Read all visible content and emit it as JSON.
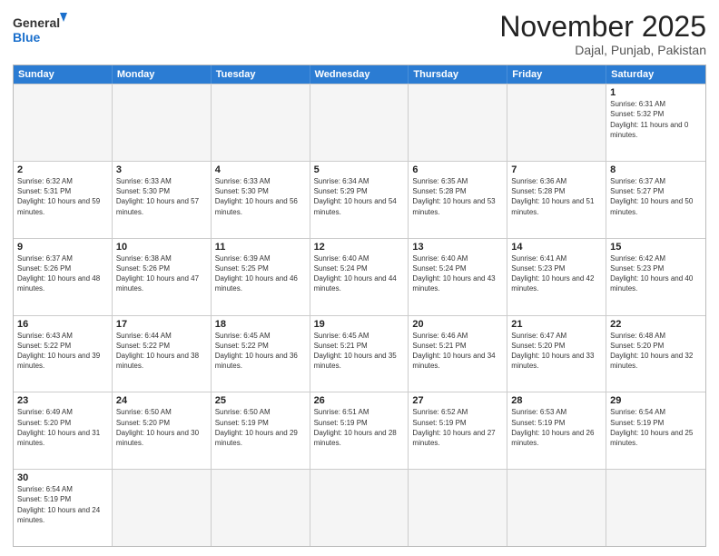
{
  "logo": {
    "text_general": "General",
    "text_blue": "Blue"
  },
  "title": "November 2025",
  "location": "Dajal, Punjab, Pakistan",
  "header_days": [
    "Sunday",
    "Monday",
    "Tuesday",
    "Wednesday",
    "Thursday",
    "Friday",
    "Saturday"
  ],
  "rows": [
    [
      {
        "day": "",
        "info": ""
      },
      {
        "day": "",
        "info": ""
      },
      {
        "day": "",
        "info": ""
      },
      {
        "day": "",
        "info": ""
      },
      {
        "day": "",
        "info": ""
      },
      {
        "day": "",
        "info": ""
      },
      {
        "day": "1",
        "info": "Sunrise: 6:31 AM\nSunset: 5:32 PM\nDaylight: 11 hours and 0 minutes."
      }
    ],
    [
      {
        "day": "2",
        "info": "Sunrise: 6:32 AM\nSunset: 5:31 PM\nDaylight: 10 hours and 59 minutes."
      },
      {
        "day": "3",
        "info": "Sunrise: 6:33 AM\nSunset: 5:30 PM\nDaylight: 10 hours and 57 minutes."
      },
      {
        "day": "4",
        "info": "Sunrise: 6:33 AM\nSunset: 5:30 PM\nDaylight: 10 hours and 56 minutes."
      },
      {
        "day": "5",
        "info": "Sunrise: 6:34 AM\nSunset: 5:29 PM\nDaylight: 10 hours and 54 minutes."
      },
      {
        "day": "6",
        "info": "Sunrise: 6:35 AM\nSunset: 5:28 PM\nDaylight: 10 hours and 53 minutes."
      },
      {
        "day": "7",
        "info": "Sunrise: 6:36 AM\nSunset: 5:28 PM\nDaylight: 10 hours and 51 minutes."
      },
      {
        "day": "8",
        "info": "Sunrise: 6:37 AM\nSunset: 5:27 PM\nDaylight: 10 hours and 50 minutes."
      }
    ],
    [
      {
        "day": "9",
        "info": "Sunrise: 6:37 AM\nSunset: 5:26 PM\nDaylight: 10 hours and 48 minutes."
      },
      {
        "day": "10",
        "info": "Sunrise: 6:38 AM\nSunset: 5:26 PM\nDaylight: 10 hours and 47 minutes."
      },
      {
        "day": "11",
        "info": "Sunrise: 6:39 AM\nSunset: 5:25 PM\nDaylight: 10 hours and 46 minutes."
      },
      {
        "day": "12",
        "info": "Sunrise: 6:40 AM\nSunset: 5:24 PM\nDaylight: 10 hours and 44 minutes."
      },
      {
        "day": "13",
        "info": "Sunrise: 6:40 AM\nSunset: 5:24 PM\nDaylight: 10 hours and 43 minutes."
      },
      {
        "day": "14",
        "info": "Sunrise: 6:41 AM\nSunset: 5:23 PM\nDaylight: 10 hours and 42 minutes."
      },
      {
        "day": "15",
        "info": "Sunrise: 6:42 AM\nSunset: 5:23 PM\nDaylight: 10 hours and 40 minutes."
      }
    ],
    [
      {
        "day": "16",
        "info": "Sunrise: 6:43 AM\nSunset: 5:22 PM\nDaylight: 10 hours and 39 minutes."
      },
      {
        "day": "17",
        "info": "Sunrise: 6:44 AM\nSunset: 5:22 PM\nDaylight: 10 hours and 38 minutes."
      },
      {
        "day": "18",
        "info": "Sunrise: 6:45 AM\nSunset: 5:22 PM\nDaylight: 10 hours and 36 minutes."
      },
      {
        "day": "19",
        "info": "Sunrise: 6:45 AM\nSunset: 5:21 PM\nDaylight: 10 hours and 35 minutes."
      },
      {
        "day": "20",
        "info": "Sunrise: 6:46 AM\nSunset: 5:21 PM\nDaylight: 10 hours and 34 minutes."
      },
      {
        "day": "21",
        "info": "Sunrise: 6:47 AM\nSunset: 5:20 PM\nDaylight: 10 hours and 33 minutes."
      },
      {
        "day": "22",
        "info": "Sunrise: 6:48 AM\nSunset: 5:20 PM\nDaylight: 10 hours and 32 minutes."
      }
    ],
    [
      {
        "day": "23",
        "info": "Sunrise: 6:49 AM\nSunset: 5:20 PM\nDaylight: 10 hours and 31 minutes."
      },
      {
        "day": "24",
        "info": "Sunrise: 6:50 AM\nSunset: 5:20 PM\nDaylight: 10 hours and 30 minutes."
      },
      {
        "day": "25",
        "info": "Sunrise: 6:50 AM\nSunset: 5:19 PM\nDaylight: 10 hours and 29 minutes."
      },
      {
        "day": "26",
        "info": "Sunrise: 6:51 AM\nSunset: 5:19 PM\nDaylight: 10 hours and 28 minutes."
      },
      {
        "day": "27",
        "info": "Sunrise: 6:52 AM\nSunset: 5:19 PM\nDaylight: 10 hours and 27 minutes."
      },
      {
        "day": "28",
        "info": "Sunrise: 6:53 AM\nSunset: 5:19 PM\nDaylight: 10 hours and 26 minutes."
      },
      {
        "day": "29",
        "info": "Sunrise: 6:54 AM\nSunset: 5:19 PM\nDaylight: 10 hours and 25 minutes."
      }
    ],
    [
      {
        "day": "30",
        "info": "Sunrise: 6:54 AM\nSunset: 5:19 PM\nDaylight: 10 hours and 24 minutes."
      },
      {
        "day": "",
        "info": ""
      },
      {
        "day": "",
        "info": ""
      },
      {
        "day": "",
        "info": ""
      },
      {
        "day": "",
        "info": ""
      },
      {
        "day": "",
        "info": ""
      },
      {
        "day": "",
        "info": ""
      }
    ]
  ]
}
